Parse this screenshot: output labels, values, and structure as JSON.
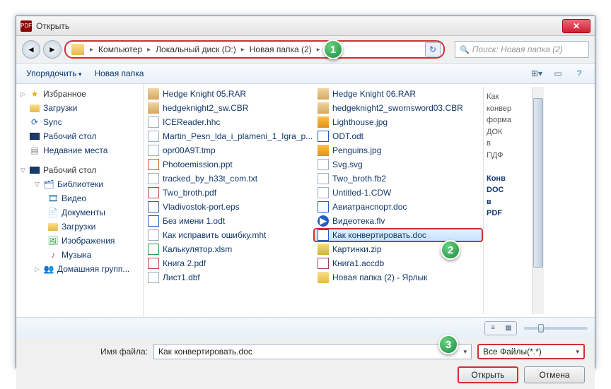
{
  "window": {
    "title": "Открыть",
    "app_badge": "PDF"
  },
  "breadcrumb": {
    "segments": [
      "Компьютер",
      "Локальный диск (D:)",
      "Новая папка (2)"
    ]
  },
  "search": {
    "placeholder": "Поиск: Новая папка (2)"
  },
  "toolbar": {
    "organize": "Упорядочить",
    "new_folder": "Новая папка"
  },
  "sidebar": {
    "favorites": {
      "label": "Избранное",
      "items": [
        "Загрузки",
        "Sync",
        "Рабочий стол",
        "Недавние места"
      ]
    },
    "desktop": {
      "label": "Рабочий стол",
      "libraries": {
        "label": "Библиотеки",
        "items": [
          "Видео",
          "Документы",
          "Загрузки",
          "Изображения",
          "Музыка"
        ]
      },
      "homegroup": "Домашняя групп..."
    }
  },
  "files": {
    "col1": [
      {
        "icon": "rar",
        "name": "Hedge Knight 05.RAR"
      },
      {
        "icon": "rar",
        "name": "hedgeknight2_sw.CBR"
      },
      {
        "icon": "gen",
        "name": "ICEReader.hhc"
      },
      {
        "icon": "txt",
        "name": "Martin_Pesn_lda_i_plameni_1_Igra_p..."
      },
      {
        "icon": "txt",
        "name": "opr00A9T.tmp"
      },
      {
        "icon": "ppt",
        "name": "Photoemission.ppt"
      },
      {
        "icon": "txt",
        "name": "tracked_by_h33t_com.txt"
      },
      {
        "icon": "pdf",
        "name": "Two_broth.pdf"
      },
      {
        "icon": "eps",
        "name": "Vladivostok-port.eps"
      },
      {
        "icon": "doc",
        "name": "Без имени 1.odt"
      },
      {
        "icon": "mht",
        "name": "Как исправить ошибку.mht"
      },
      {
        "icon": "xls",
        "name": "Калькулятор.xlsm"
      },
      {
        "icon": "pdf",
        "name": "Книга 2.pdf"
      },
      {
        "icon": "gen",
        "name": "Лист1.dbf"
      }
    ],
    "col2": [
      {
        "icon": "rar",
        "name": "Hedge Knight 06.RAR"
      },
      {
        "icon": "rar",
        "name": "hedgeknight2_swornsword03.CBR"
      },
      {
        "icon": "img",
        "name": "Lighthouse.jpg"
      },
      {
        "icon": "doc",
        "name": "ODT.odt"
      },
      {
        "icon": "img",
        "name": "Penguins.jpg"
      },
      {
        "icon": "gen",
        "name": "Svg.svg"
      },
      {
        "icon": "txt",
        "name": "Two_broth.fb2"
      },
      {
        "icon": "gen",
        "name": "Untitled-1.CDW"
      },
      {
        "icon": "doc",
        "name": "Авиатранспорт.doc"
      },
      {
        "icon": "vid",
        "name": "Видеотека.flv"
      },
      {
        "icon": "doc",
        "name": "Как конвертировать.doc",
        "selected": true
      },
      {
        "icon": "zip",
        "name": "Картинки.zip"
      },
      {
        "icon": "db",
        "name": "Книга1.accdb"
      },
      {
        "icon": "fld",
        "name": "Новая папка (2) - Ярлык"
      }
    ]
  },
  "preview": {
    "lines": [
      "Как",
      "конвер",
      "форма",
      "ДОК",
      "в",
      "ПДФ",
      "",
      "Конв",
      "DOC",
      "в",
      "PDF"
    ]
  },
  "filename": {
    "label": "Имя файла:",
    "value": "Как конвертировать.doc"
  },
  "filter": {
    "value": "Все Файлы(*.*)"
  },
  "buttons": {
    "open": "Открыть",
    "cancel": "Отмена"
  },
  "badges": {
    "b1": "1",
    "b2": "2",
    "b3": "3"
  }
}
